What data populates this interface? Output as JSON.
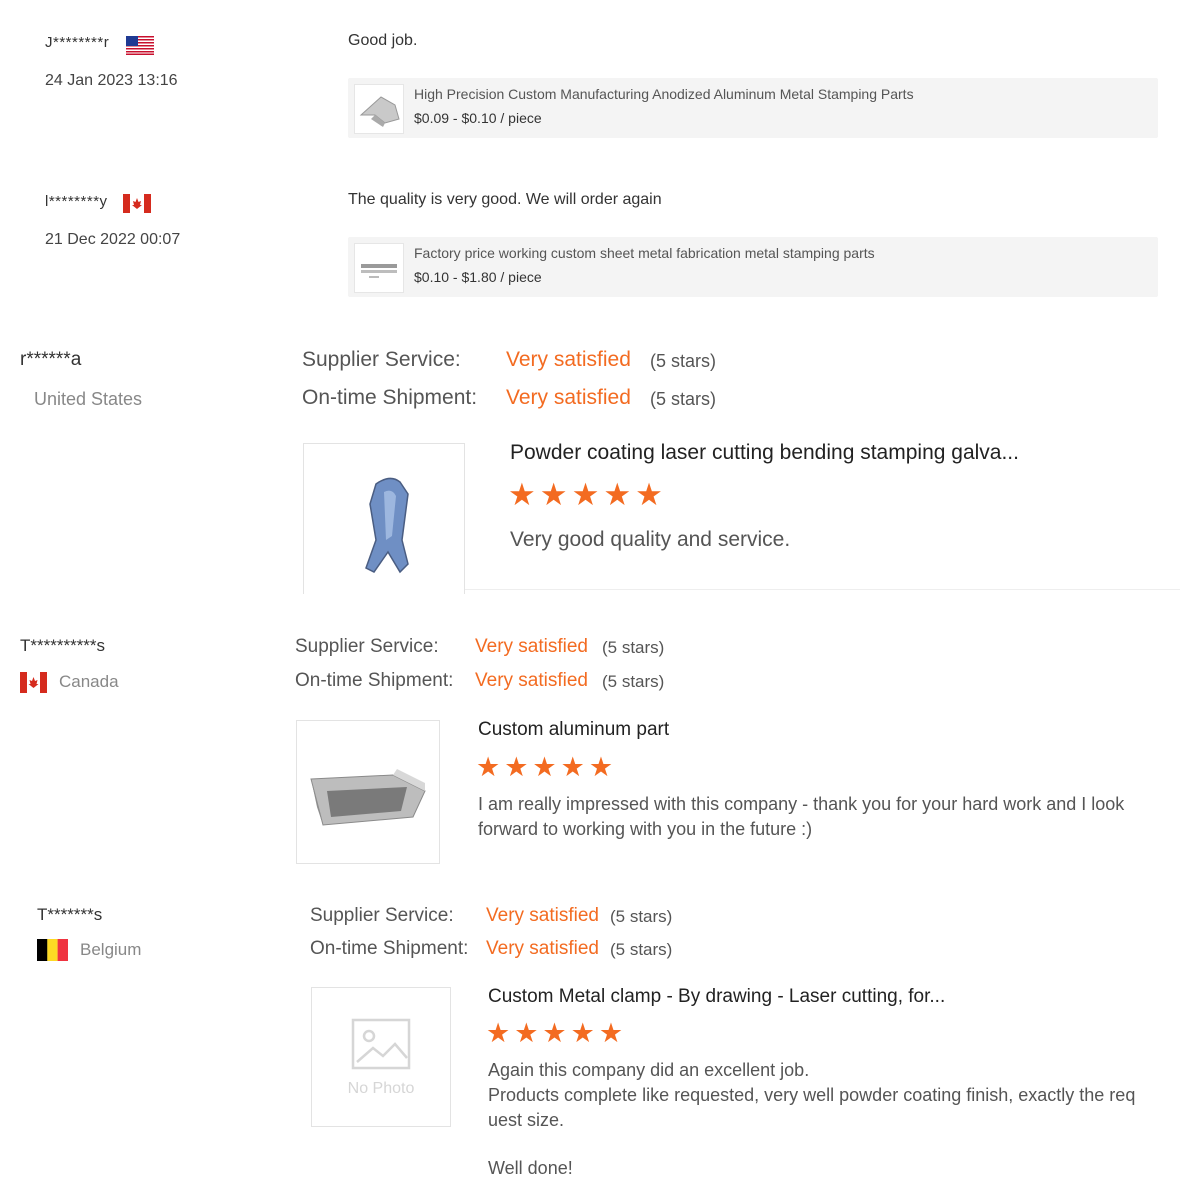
{
  "reviews_compact": [
    {
      "name": "J********r",
      "date": "24 Jan 2023 13:16",
      "comment": "Good job.",
      "product_title": "High Precision Custom Manufacturing Anodized Aluminum Metal Stamping Parts",
      "product_price": "$0.09 - $0.10 / piece",
      "flag_icon": "us-flag-icon"
    },
    {
      "name": "l********y",
      "date": "21 Dec 2022 00:07",
      "comment": "The quality is very good. We will order again",
      "product_title": "Factory price working custom sheet metal fabrication metal stamping parts",
      "product_price": "$0.10 - $1.80 / piece",
      "flag_icon": "canada-flag-icon"
    }
  ],
  "reviews_detailed": [
    {
      "name": "r******a",
      "country": "United States",
      "supplier_label": "Supplier Service:",
      "supplier_value": "Very satisfied",
      "supplier_stars": "(5 stars)",
      "shipment_label": "On-time Shipment:",
      "shipment_value": "Very satisfied",
      "shipment_stars": "(5 stars)",
      "product_title": "Powder coating laser cutting bending stamping galva...",
      "rating": 5,
      "stars": "★★★★★",
      "text": "Very good quality and service."
    },
    {
      "name": "T**********s",
      "country": "Canada",
      "supplier_label": "Supplier Service:",
      "supplier_value": "Very satisfied",
      "supplier_stars": "(5 stars)",
      "shipment_label": "On-time Shipment:",
      "shipment_value": "Very satisfied",
      "shipment_stars": "(5 stars)",
      "product_title": "Custom aluminum part",
      "rating": 5,
      "stars": "★★★★★",
      "text_line1": "I am really impressed with this company - thank you for your hard work and I look",
      "text_line2": "forward to working with you in the future :)"
    },
    {
      "name": "T*******s",
      "country": "Belgium",
      "supplier_label": "Supplier Service:",
      "supplier_value": "Very satisfied",
      "supplier_stars": "(5 stars)",
      "shipment_label": "On-time Shipment:",
      "shipment_value": "Very satisfied",
      "shipment_stars": "(5 stars)",
      "product_title": "Custom Metal clamp - By drawing - Laser cutting, for...",
      "rating": 5,
      "stars": "★★★★★",
      "no_photo": "No Photo",
      "text_line1": "Again this company did an excellent job.",
      "text_line2": "Products complete like requested, very well powder coating finish, exactly the req",
      "text_line3": "uest size.",
      "text_line4": "Well done!"
    }
  ],
  "colors": {
    "accent": "#f36b21"
  }
}
